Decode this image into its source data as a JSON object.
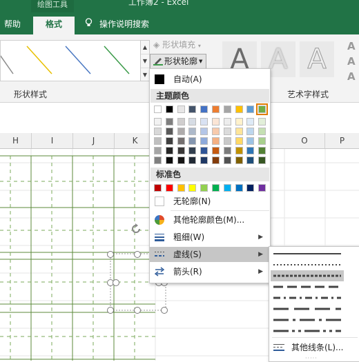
{
  "ribbon": {
    "context_tab": "绘图工具",
    "window_title": "工作簿2 - Excel",
    "tabs": [
      {
        "label": "帮助"
      },
      {
        "label": "格式",
        "active": true
      },
      {
        "label": "操作说明搜索"
      }
    ],
    "shape_fill_label": "形状填充",
    "shape_outline_label": "形状轮廓",
    "group_shape_styles": "形状样式",
    "group_wordart_styles": "艺术字样式",
    "wordart_letter": "A",
    "gallery_colors": [
      "#8a8a8a",
      "#e8c000",
      "#4a78c2",
      "#3a9a48"
    ]
  },
  "sheet": {
    "columns": [
      "H",
      "I",
      "J",
      "K",
      "O",
      "P"
    ]
  },
  "outline_menu": {
    "auto_label": "自动(A)",
    "theme_colors_header": "主题颜色",
    "standard_colors_header": "标准色",
    "no_outline": "无轮廓(N)",
    "more_colors": "其他轮廓颜色(M)...",
    "weight": "粗细(W)",
    "dashes": "虚线(S)",
    "arrows": "箭头(R)",
    "theme_top": [
      "#ffffff",
      "#000000",
      "#e7e6e6",
      "#44546a",
      "#4472c4",
      "#ed7d31",
      "#a5a5a5",
      "#ffc000",
      "#5b9bd5",
      "#70ad47"
    ],
    "theme_shades": [
      [
        "#f2f2f2",
        "#7f7f7f",
        "#d0cece",
        "#d6dce4",
        "#d9e2f3",
        "#fbe5d5",
        "#ededed",
        "#fff2cc",
        "#deeaf6",
        "#e2efd9"
      ],
      [
        "#d8d8d8",
        "#595959",
        "#aeabab",
        "#adb9ca",
        "#b4c6e7",
        "#f7caac",
        "#dbdbdb",
        "#fee599",
        "#bdd7ee",
        "#c5e0b3"
      ],
      [
        "#bfbfbf",
        "#3f3f3f",
        "#757070",
        "#8496b0",
        "#8eaadb",
        "#f4b083",
        "#c9c9c9",
        "#ffd965",
        "#9cc3e5",
        "#a8d08d"
      ],
      [
        "#a5a5a5",
        "#262626",
        "#3a3838",
        "#323f4f",
        "#2f5496",
        "#c55a11",
        "#7b7b7b",
        "#bf9000",
        "#2e75b5",
        "#538135"
      ],
      [
        "#7f7f7f",
        "#0c0c0c",
        "#171616",
        "#222a35",
        "#1f3864",
        "#833c0b",
        "#525252",
        "#7f6000",
        "#1e4e79",
        "#375623"
      ]
    ],
    "standard": [
      "#c00000",
      "#ff0000",
      "#ffc000",
      "#ffff00",
      "#92d050",
      "#00b050",
      "#00b0f0",
      "#0070c0",
      "#002060",
      "#7030a0"
    ]
  },
  "dash_menu": {
    "more_lines": "其他线条(L)...",
    "items": [
      "solid",
      "round-dot",
      "square-dot",
      "dash",
      "dash-dot",
      "long-dash",
      "long-dash-dot",
      "long-dash-dot-dot"
    ],
    "selected": "square-dot"
  }
}
